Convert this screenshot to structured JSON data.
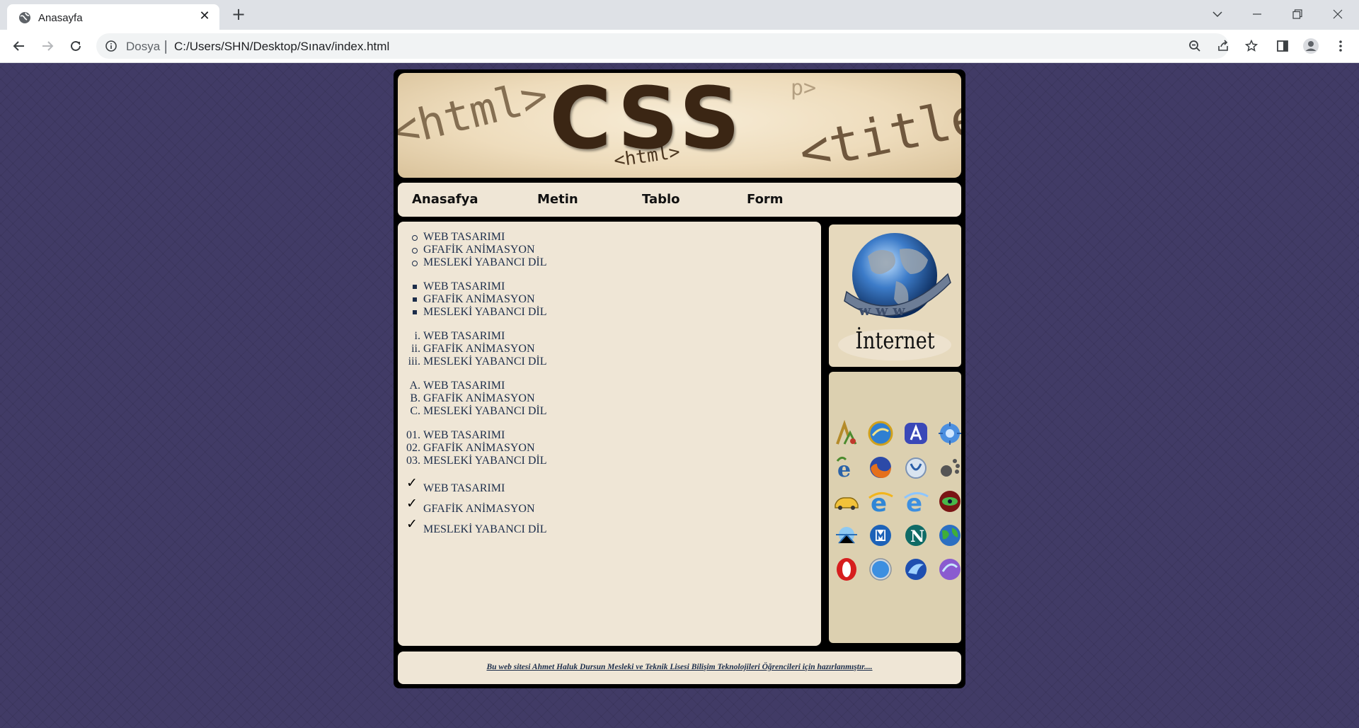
{
  "browser": {
    "tab_title": "Anasayfa",
    "address_scheme": "Dosya",
    "address_url": "C:/Users/SHN/Desktop/Sınav/index.html"
  },
  "site": {
    "banner": {
      "main_text": "CSS",
      "bg_text_left": "<html>",
      "bg_text_right": "<title>",
      "bg_text_small": "<html>",
      "bg_text_corner": "p>"
    },
    "nav": [
      "Anasafya",
      "Metin",
      "Tablo",
      "Form"
    ],
    "lists": {
      "items": [
        "WEB TASARIMI",
        "GFAFİK ANİMASYON",
        "MESLEKİ YABANCI DİL"
      ],
      "roman_markers": [
        "i.",
        "ii.",
        "iii."
      ],
      "alpha_markers": [
        "A.",
        "B.",
        "C."
      ],
      "decimal_markers": [
        "01.",
        "02.",
        "03."
      ]
    },
    "side_image_text": "İnternet",
    "footer_text": "Bu web sitesi Ahmet Haluk Dursun Mesleki ve Teknik Lisesi Bilişim Teknolojileri Öğrencileri için hazırlanmıştır...."
  },
  "colors": {
    "page_bg": "#413b66",
    "panel_bg": "#efe6d6",
    "text": "#1c2d4a",
    "frame_accent": "#7fc241"
  },
  "icons": [
    "tab-favicon-globe-icon",
    "tab-close-icon",
    "new-tab-icon",
    "chevron-down-icon",
    "minimize-icon",
    "restore-icon",
    "window-close-icon",
    "back-icon",
    "forward-icon",
    "reload-icon",
    "info-icon",
    "zoom-icon",
    "share-icon",
    "star-icon",
    "side-panel-icon",
    "profile-icon",
    "menu-icon"
  ]
}
